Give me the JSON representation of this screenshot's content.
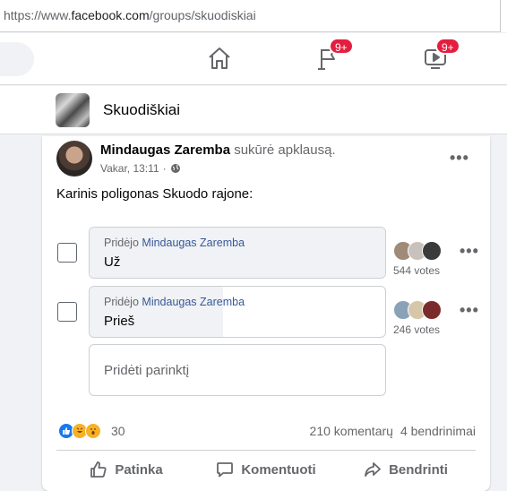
{
  "browser": {
    "url_prefix": "https://www.",
    "url_domain": "facebook.com",
    "url_path": "/groups/skuodiskiai"
  },
  "nav": {
    "flag_badge": "9+",
    "watch_badge": "9+"
  },
  "group": {
    "name": "Skuodiškiai"
  },
  "post": {
    "author": "Mindaugas Zaremba",
    "action": "sukūrė apklausą.",
    "time": "Vakar, 13:11",
    "privacy_sep": "·",
    "text": "Karinis poligonas Skuodo rajone:"
  },
  "poll": {
    "added_prefix": "Pridėjo",
    "options": [
      {
        "added_by": "Mindaugas Zaremba",
        "label": "Už",
        "votes": "544 votes",
        "share": 1.0
      },
      {
        "added_by": "Mindaugas Zaremba",
        "label": "Prieš",
        "votes": "246 votes",
        "share": 0.45
      }
    ],
    "add_option_placeholder": "Pridėti parinktį"
  },
  "footer": {
    "reaction_count": "30",
    "comments": "210 komentarų",
    "shares": "4 bendrinimai",
    "like_label": "Patinka",
    "comment_label": "Komentuoti",
    "share_label": "Bendrinti"
  },
  "colors": {
    "accent": "#1877f2",
    "badge": "#e41e3f",
    "link": "#385898"
  }
}
